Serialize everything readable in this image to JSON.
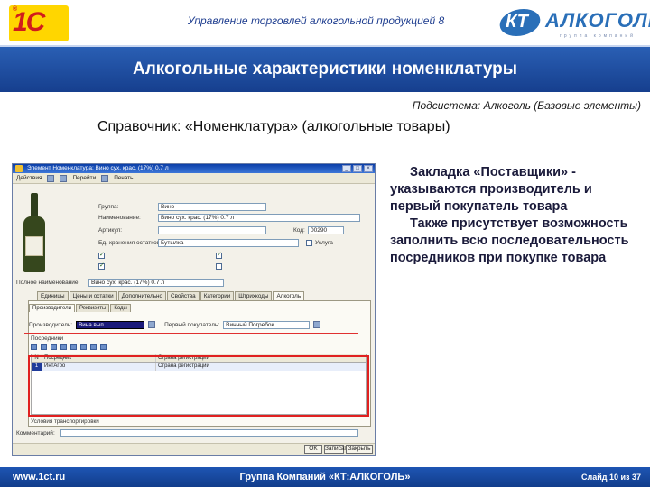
{
  "header": {
    "top_title": "Управление торговлей алкогольной продукцией 8",
    "logo_1c": "1С",
    "logo_kt_mark": "КТ",
    "logo_kt_word": "АЛКОГОЛЬ",
    "logo_kt_sub": "группа компаний",
    "banner_title": "Алкогольные характеристики номенклатуры"
  },
  "subsystem": "Подсистема: Алкоголь (Базовые элементы)",
  "reference": "Справочник: «Номенклатура» (алкогольные товары)",
  "description": {
    "para1": "Закладка «Поставщики» - указываются производитель и первый покупатель товара",
    "para2": "Также присутствует возможность заполнить всю последовательность посредников при покупке товара"
  },
  "window": {
    "title": "Элемент Номенклатура: Вино сух. крас. (17%) 0.7 л",
    "toolbar": [
      "Действия",
      "Перейти",
      "Печать"
    ],
    "fields": {
      "group_label": "Группа:",
      "group_value": "Вино",
      "name_label": "Наименование:",
      "name_value": "Вино сух. крас. (17%) 0.7 л",
      "article_label": "Артикул:",
      "code_label": "Код:",
      "code_value": "00290",
      "unit_label": "Ед. хранения остатков:",
      "unit_value": "Бутылка",
      "service_label": "Услуга",
      "full_name_label": "Полное наименование:",
      "full_name_value": "Вино сух. крас. (17%) 0.7 л"
    },
    "tabs": [
      "Единицы",
      "Цены и остатки",
      "Дополнительно",
      "Свойства",
      "Категории",
      "Штрихкоды",
      "Алкоголь"
    ],
    "subtabs": [
      "Производители",
      "Реквизиты",
      "Коды"
    ],
    "producer_label": "Производитель:",
    "producer_value": "Вина вып.",
    "buyer_label": "Первый покупатель:",
    "buyer_value": "Винный Погребок",
    "intermediaries_label": "Посредники",
    "grid_headers": [
      "N",
      "Посредник",
      "Страна регистрации"
    ],
    "grid_rows": [
      {
        "n": "1",
        "name": "ИнтАгро",
        "country": "Страна регистрации"
      }
    ],
    "conditions_label": "Условия транспортировки",
    "comment_label": "Комментарий:",
    "ok_label": "OK",
    "save_label": "Записать",
    "close_label": "Закрыть"
  },
  "footer": {
    "site": "www.1ct.ru",
    "company": "Группа Компаний «КТ:АЛКОГОЛЬ»",
    "slide": "Слайд 10 из 37"
  }
}
